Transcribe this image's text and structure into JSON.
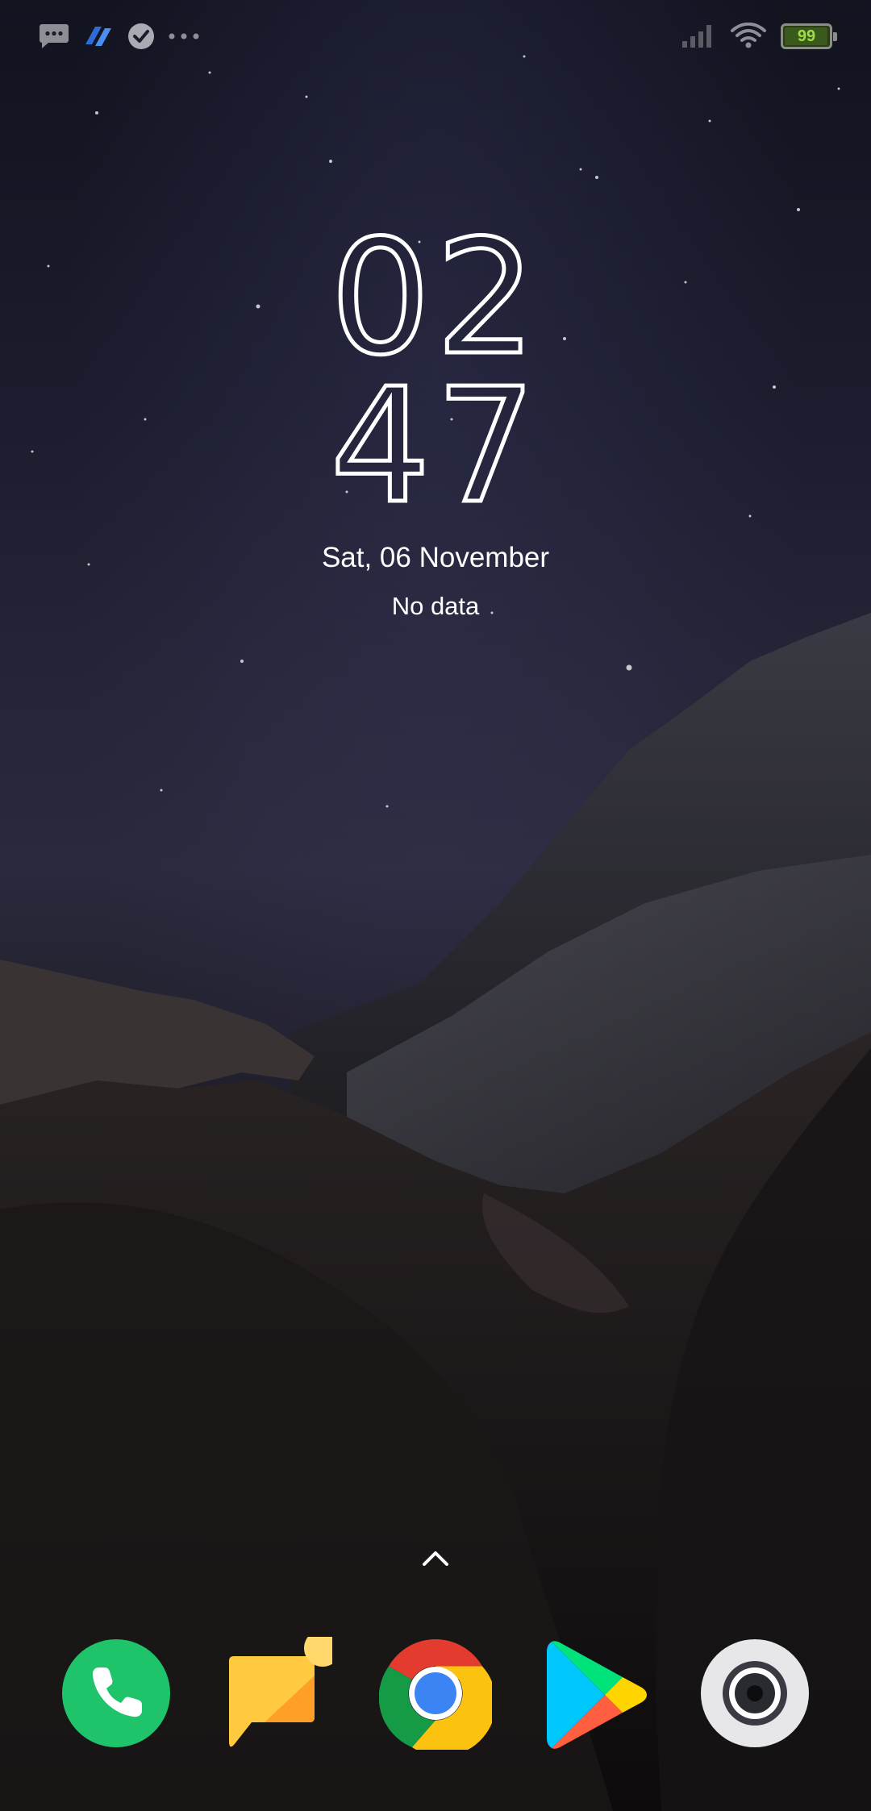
{
  "status_bar": {
    "left_icons": [
      "message-icon",
      "app-logo-icon",
      "check-circle-icon",
      "more-dots-icon"
    ],
    "right_icons": [
      "signal-icon",
      "wifi-icon",
      "battery-icon"
    ],
    "battery_level": "99"
  },
  "lockscreen": {
    "clock_hours": "02",
    "clock_minutes": "47",
    "date": "Sat, 06 November",
    "subinfo": "No data"
  },
  "swipe_hint_icon": "chevron-up-icon",
  "dock": {
    "apps": [
      {
        "name": "phone",
        "icon": "phone-icon",
        "color": "#1ec36a"
      },
      {
        "name": "notes",
        "icon": "notes-icon",
        "color": "#ffc940"
      },
      {
        "name": "chrome",
        "icon": "chrome-icon",
        "color": "#4285f4"
      },
      {
        "name": "play-store",
        "icon": "play-store-icon",
        "color": "#00d7fe"
      },
      {
        "name": "camera",
        "icon": "camera-icon",
        "color": "#e7e7ea"
      }
    ]
  }
}
